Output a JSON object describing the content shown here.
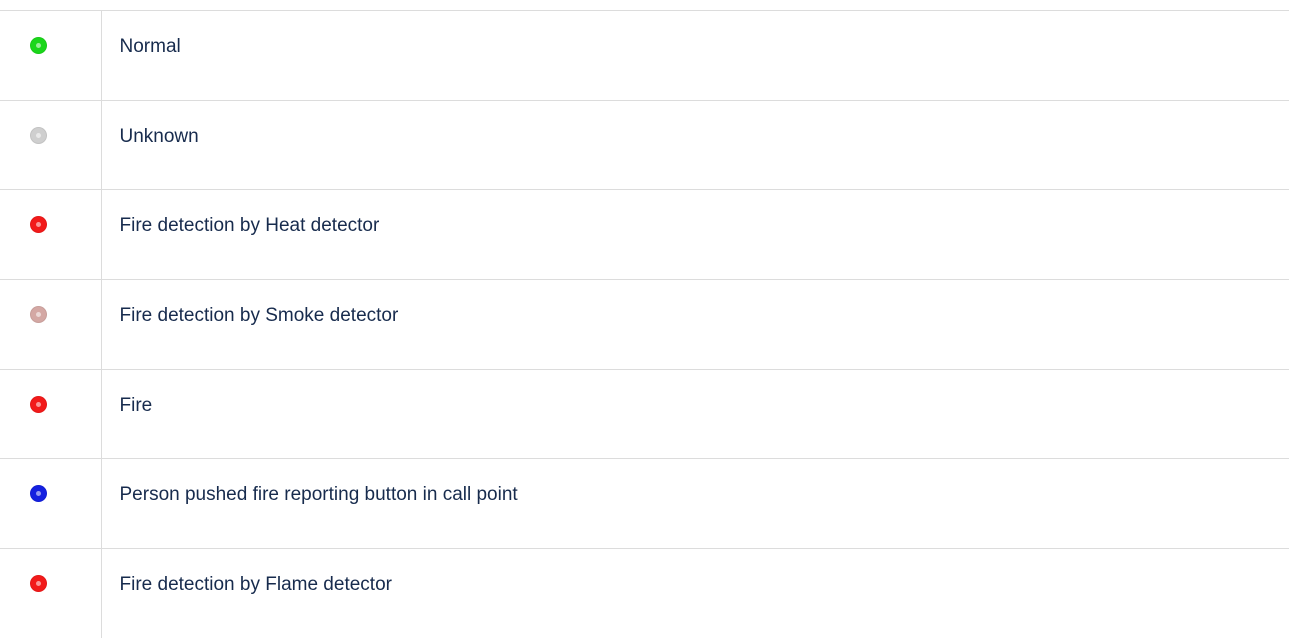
{
  "statuses": [
    {
      "label": "Normal",
      "icon": "green-status-dot-icon",
      "color": "#1ad61a"
    },
    {
      "label": "Unknown",
      "icon": "gray-status-dot-icon",
      "color": "#cfcfcf"
    },
    {
      "label": "Fire detection by Heat detector",
      "icon": "red-status-dot-icon",
      "color": "#f21a1a"
    },
    {
      "label": "Fire detection by Smoke detector",
      "icon": "pink-status-dot-icon",
      "color": "#d4a8a4"
    },
    {
      "label": "Fire",
      "icon": "red-status-dot-icon",
      "color": "#f21a1a"
    },
    {
      "label": "Person pushed fire reporting button in call point",
      "icon": "blue-status-dot-icon",
      "color": "#1420e0"
    },
    {
      "label": "Fire detection by Flame detector",
      "icon": "red-status-dot-icon",
      "color": "#f21a1a"
    }
  ]
}
